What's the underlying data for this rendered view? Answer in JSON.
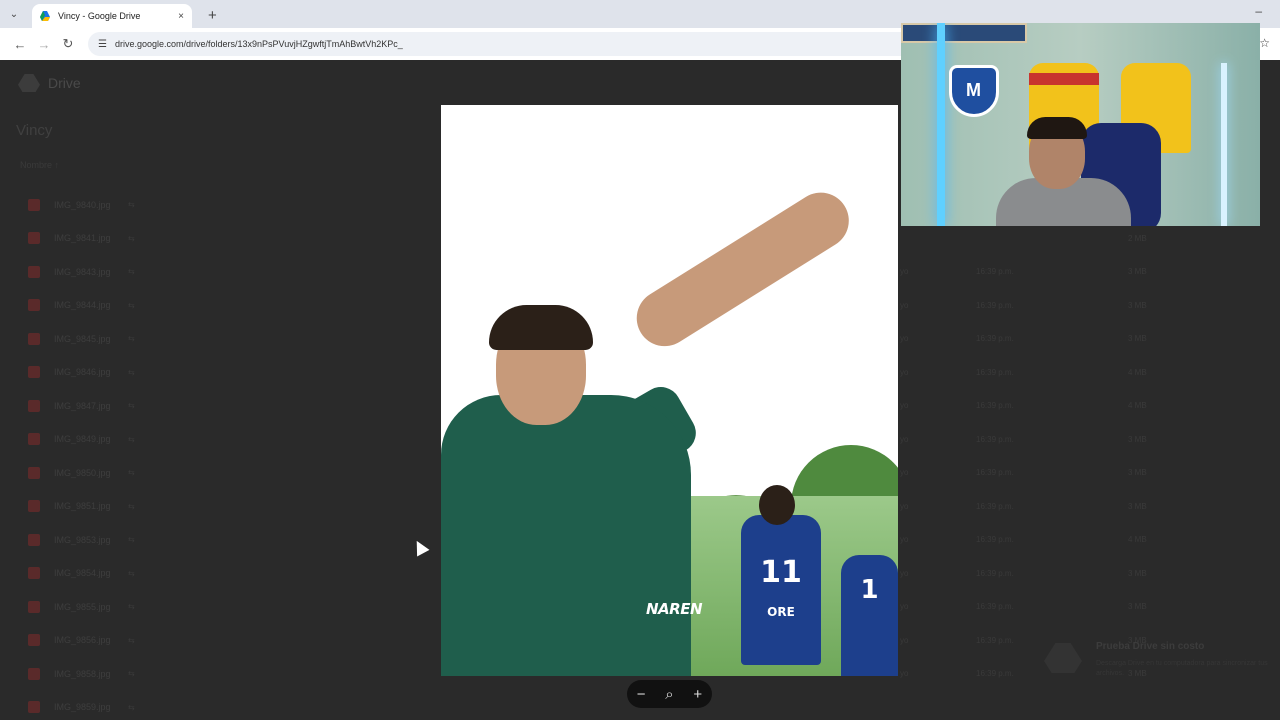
{
  "browser": {
    "tab_title": "Vincy - Google Drive",
    "url": "drive.google.com/drive/folders/13x9nPsPVuvjHZgwftjTmAhBwtVh2KPc_",
    "new_tab_label": "+",
    "close_tab_label": "×"
  },
  "drive": {
    "app_name": "Drive",
    "folder_name": "Vincy",
    "sort_label": "Nombre ↑",
    "files": [
      {
        "name": "IMG_9840.jpg",
        "owner": "",
        "modified": "",
        "size": ""
      },
      {
        "name": "IMG_9841.jpg",
        "owner": "",
        "modified": "",
        "size": "2 MB"
      },
      {
        "name": "IMG_9843.jpg",
        "owner": "yo",
        "modified": "16:39 p.m.",
        "size": "3 MB"
      },
      {
        "name": "IMG_9844.jpg",
        "owner": "yo",
        "modified": "16:39 p.m.",
        "size": "3 MB"
      },
      {
        "name": "IMG_9845.jpg",
        "owner": "yo",
        "modified": "16:39 p.m.",
        "size": "3 MB"
      },
      {
        "name": "IMG_9846.jpg",
        "owner": "yo",
        "modified": "16:39 p.m.",
        "size": "4 MB"
      },
      {
        "name": "IMG_9847.jpg",
        "owner": "yo",
        "modified": "16:39 p.m.",
        "size": "4 MB"
      },
      {
        "name": "IMG_9849.jpg",
        "owner": "yo",
        "modified": "16:39 p.m.",
        "size": "3 MB"
      },
      {
        "name": "IMG_9850.jpg",
        "owner": "yo",
        "modified": "16:39 p.m.",
        "size": "3 MB"
      },
      {
        "name": "IMG_9851.jpg",
        "owner": "yo",
        "modified": "16:39 p.m.",
        "size": "3 MB"
      },
      {
        "name": "IMG_9853.jpg",
        "owner": "yo",
        "modified": "16:39 p.m.",
        "size": "4 MB"
      },
      {
        "name": "IMG_9854.jpg",
        "owner": "yo",
        "modified": "16:39 p.m.",
        "size": "3 MB"
      },
      {
        "name": "IMG_9855.jpg",
        "owner": "yo",
        "modified": "16:39 p.m.",
        "size": "3 MB"
      },
      {
        "name": "IMG_9856.jpg",
        "owner": "yo",
        "modified": "16:39 p.m.",
        "size": "3 MB"
      },
      {
        "name": "IMG_9858.jpg",
        "owner": "yo",
        "modified": "16:39 p.m.",
        "size": "3 MB"
      },
      {
        "name": "IMG_9859.jpg",
        "owner": "",
        "modified": "",
        "size": ""
      }
    ],
    "promo_title": "Prueba Drive sin costo",
    "promo_text": "Descarga Drive en tu computadora para sincronizar tus archivos."
  },
  "preview": {
    "watermark": "NAREN",
    "jersey_numbers": [
      "11",
      "1"
    ],
    "jersey_text": "ORE"
  },
  "zoom": {
    "zoom_out": "−",
    "zoom_reset": "⌕",
    "zoom_in": "+"
  },
  "webcam": {
    "crest_letter": "M"
  }
}
